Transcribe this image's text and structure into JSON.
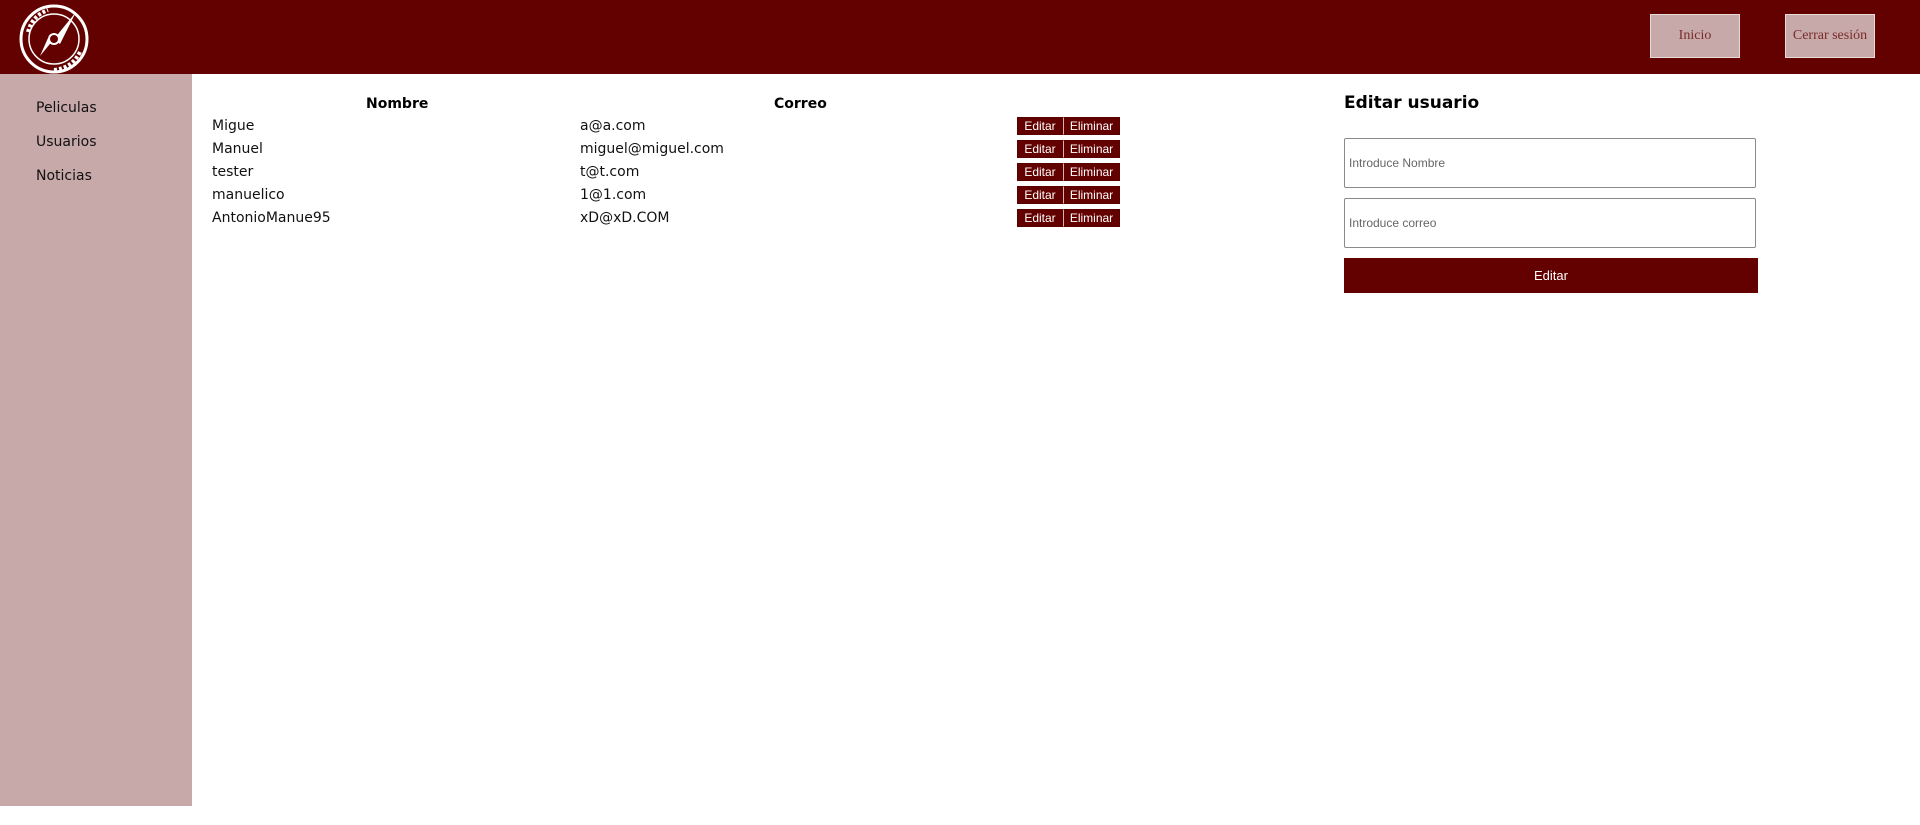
{
  "header": {
    "nav": [
      {
        "label": "Inicio"
      },
      {
        "label": "Cerrar sesión"
      }
    ]
  },
  "sidebar": {
    "items": [
      {
        "label": "Peliculas"
      },
      {
        "label": "Usuarios"
      },
      {
        "label": "Noticias"
      }
    ]
  },
  "table": {
    "headers": {
      "name": "Nombre",
      "email": "Correo"
    },
    "action_labels": {
      "edit": "Editar",
      "delete": "Eliminar"
    },
    "rows": [
      {
        "name": "Migue",
        "email": "a@a.com"
      },
      {
        "name": "Manuel",
        "email": "miguel@miguel.com"
      },
      {
        "name": "tester",
        "email": "t@t.com"
      },
      {
        "name": "manuelico",
        "email": "1@1.com"
      },
      {
        "name": "AntonioManue95",
        "email": "xD@xD.COM"
      }
    ]
  },
  "edit_form": {
    "title": "Editar usuario",
    "name_placeholder": "Introduce Nombre",
    "name_value": "",
    "email_placeholder": "Introduce correo",
    "email_value": "",
    "submit_label": "Editar"
  },
  "colors": {
    "primary": "#630000",
    "sidebar": "#c8a9a9",
    "background": "#ffffff"
  }
}
